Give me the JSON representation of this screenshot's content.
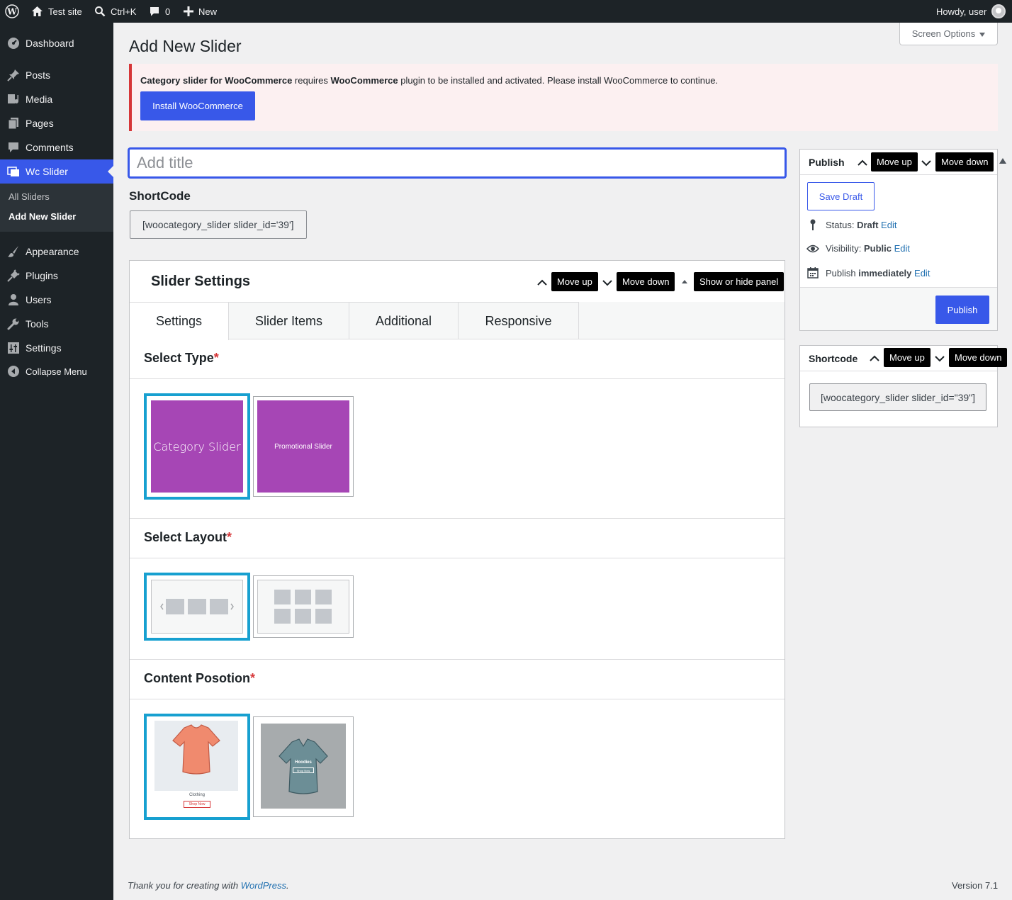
{
  "adminbar": {
    "site_name": "Test site",
    "search_shortcut": "Ctrl+K",
    "comments_count": "0",
    "new_label": "New",
    "howdy": "Howdy, user"
  },
  "sidebar": {
    "items": [
      {
        "label": "Dashboard",
        "icon": "dashboard-icon"
      },
      {
        "label": "Posts",
        "icon": "pin-icon"
      },
      {
        "label": "Media",
        "icon": "media-icon"
      },
      {
        "label": "Pages",
        "icon": "pages-icon"
      },
      {
        "label": "Comments",
        "icon": "comment-icon"
      },
      {
        "label": "Wc Slider",
        "icon": "slides-icon"
      },
      {
        "label": "Appearance",
        "icon": "brush-icon"
      },
      {
        "label": "Plugins",
        "icon": "plug-icon"
      },
      {
        "label": "Users",
        "icon": "user-icon"
      },
      {
        "label": "Tools",
        "icon": "wrench-icon"
      },
      {
        "label": "Settings",
        "icon": "sliders-icon"
      },
      {
        "label": "Collapse Menu",
        "icon": "collapse-icon"
      }
    ],
    "submenu": [
      "All Sliders",
      "Add New Slider"
    ]
  },
  "screen_options": "Screen Options",
  "page_title": "Add New Slider",
  "notice": {
    "plugin": "Category slider for WooCommerce",
    "requires": " requires ",
    "dependency": "WooCommerce",
    "rest": " plugin to be installed and activated. Please install WooCommerce to continue.",
    "button": "Install WooCommerce"
  },
  "title_placeholder": "Add title",
  "shortcode": {
    "label": "ShortCode",
    "value": "[woocategory_slider slider_id='39']"
  },
  "panel": {
    "title": "Slider Settings",
    "move_up": "Move up",
    "move_down": "Move down",
    "toggle": "Show or hide panel",
    "tabs": [
      "Settings",
      "Slider Items",
      "Additional",
      "Responsive"
    ],
    "select_type": "Select Type",
    "select_layout": "Select Layout",
    "content_position": "Content Posotion",
    "required_mark": "*",
    "type_options": [
      "Category Slider",
      "Promotional Slider"
    ],
    "content_option_1": {
      "caption": "Clothing",
      "button": "Shop Now"
    },
    "content_option_2": {
      "caption": "Hoodies",
      "button": "Shop Now"
    }
  },
  "publish": {
    "title": "Publish",
    "move_up": "Move up",
    "move_down": "Move down",
    "save_draft": "Save Draft",
    "status_label": "Status: ",
    "status_value": "Draft",
    "visibility_label": "Visibility: ",
    "visibility_value": "Public",
    "publish_label": "Publish ",
    "publish_value": "immediately",
    "edit": "Edit",
    "publish_button": "Publish"
  },
  "shortcode_box": {
    "title": "Shortcode",
    "move_up": "Move up",
    "move_down": "Move down",
    "value": "[woocategory_slider slider_id=\"39\"]"
  },
  "footer": {
    "thanks_prefix": "Thank you for creating with ",
    "wordpress": "WordPress",
    "period": ".",
    "version": "Version 7.1"
  },
  "colors": {
    "accent": "#3858e9",
    "selected_border": "#17a0d0",
    "swatch_purple": "#a646b5",
    "notice_border": "#d63638"
  }
}
